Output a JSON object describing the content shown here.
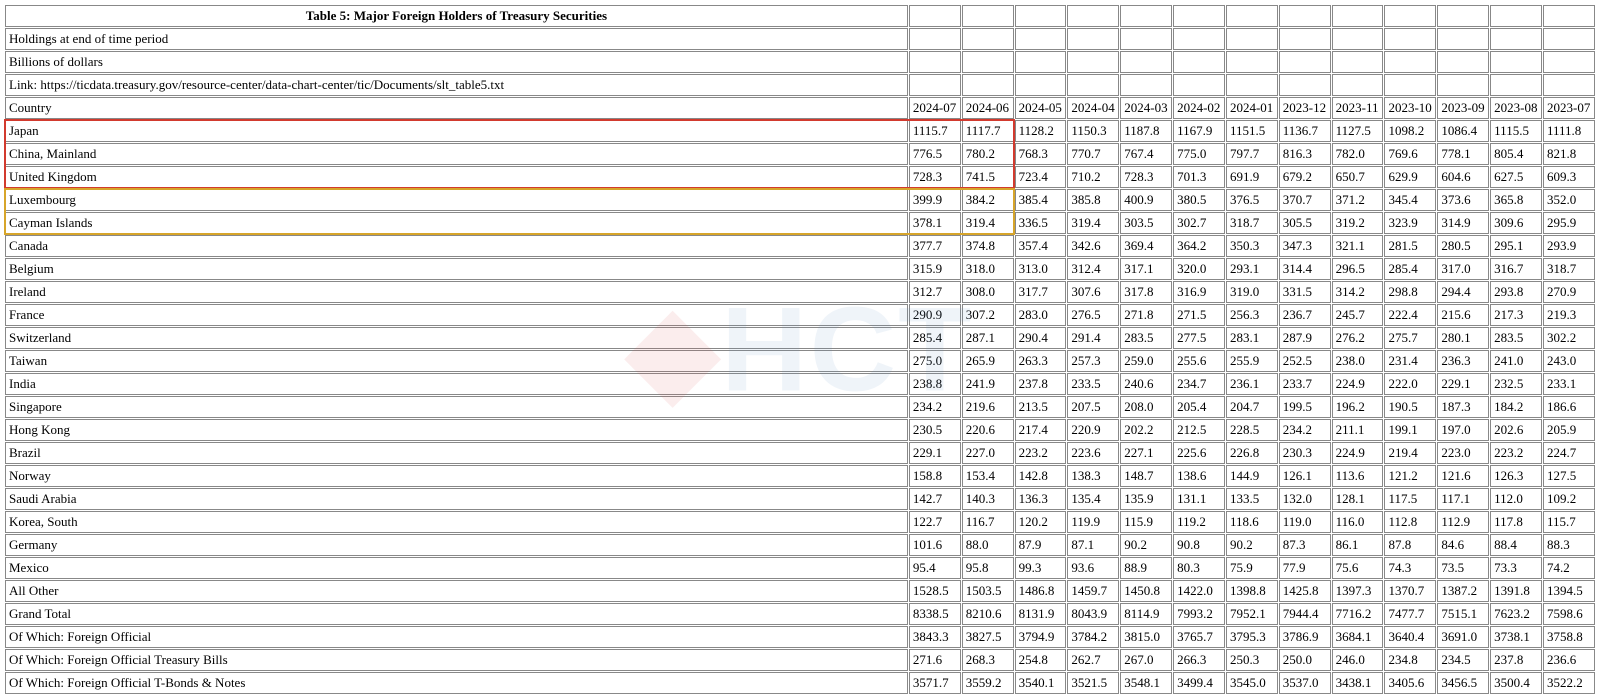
{
  "title": "Table 5: Major Foreign Holders of Treasury Securities",
  "meta": [
    "Holdings at end of time period",
    "Billions of dollars",
    "Link: https://ticdata.treasury.gov/resource-center/data-chart-center/tic/Documents/slt_table5.txt"
  ],
  "header_label": "Country",
  "periods": [
    "2024-07",
    "2024-06",
    "2024-05",
    "2024-04",
    "2024-03",
    "2024-02",
    "2024-01",
    "2023-12",
    "2023-11",
    "2023-10",
    "2023-09",
    "2023-08",
    "2023-07"
  ],
  "rows": [
    {
      "label": "Japan",
      "v": [
        "1115.7",
        "1117.7",
        "1128.2",
        "1150.3",
        "1187.8",
        "1167.9",
        "1151.5",
        "1136.7",
        "1127.5",
        "1098.2",
        "1086.4",
        "1115.5",
        "1111.8"
      ]
    },
    {
      "label": "China, Mainland",
      "v": [
        "776.5",
        "780.2",
        "768.3",
        "770.7",
        "767.4",
        "775.0",
        "797.7",
        "816.3",
        "782.0",
        "769.6",
        "778.1",
        "805.4",
        "821.8"
      ]
    },
    {
      "label": "United Kingdom",
      "v": [
        "728.3",
        "741.5",
        "723.4",
        "710.2",
        "728.3",
        "701.3",
        "691.9",
        "679.2",
        "650.7",
        "629.9",
        "604.6",
        "627.5",
        "609.3"
      ]
    },
    {
      "label": "Luxembourg",
      "v": [
        "399.9",
        "384.2",
        "385.4",
        "385.8",
        "400.9",
        "380.5",
        "376.5",
        "370.7",
        "371.2",
        "345.4",
        "373.6",
        "365.8",
        "352.0"
      ]
    },
    {
      "label": "Cayman Islands",
      "v": [
        "378.1",
        "319.4",
        "336.5",
        "319.4",
        "303.5",
        "302.7",
        "318.7",
        "305.5",
        "319.2",
        "323.9",
        "314.9",
        "309.6",
        "295.9"
      ]
    },
    {
      "label": "Canada",
      "v": [
        "377.7",
        "374.8",
        "357.4",
        "342.6",
        "369.4",
        "364.2",
        "350.3",
        "347.3",
        "321.1",
        "281.5",
        "280.5",
        "295.1",
        "293.9"
      ]
    },
    {
      "label": "Belgium",
      "v": [
        "315.9",
        "318.0",
        "313.0",
        "312.4",
        "317.1",
        "320.0",
        "293.1",
        "314.4",
        "296.5",
        "285.4",
        "317.0",
        "316.7",
        "318.7"
      ]
    },
    {
      "label": "Ireland",
      "v": [
        "312.7",
        "308.0",
        "317.7",
        "307.6",
        "317.8",
        "316.9",
        "319.0",
        "331.5",
        "314.2",
        "298.8",
        "294.4",
        "293.8",
        "270.9"
      ]
    },
    {
      "label": "France",
      "v": [
        "290.9",
        "307.2",
        "283.0",
        "276.5",
        "271.8",
        "271.5",
        "256.3",
        "236.7",
        "245.7",
        "222.4",
        "215.6",
        "217.3",
        "219.3"
      ]
    },
    {
      "label": "Switzerland",
      "v": [
        "285.4",
        "287.1",
        "290.4",
        "291.4",
        "283.5",
        "277.5",
        "283.1",
        "287.9",
        "276.2",
        "275.7",
        "280.1",
        "283.5",
        "302.2"
      ]
    },
    {
      "label": "Taiwan",
      "v": [
        "275.0",
        "265.9",
        "263.3",
        "257.3",
        "259.0",
        "255.6",
        "255.9",
        "252.5",
        "238.0",
        "231.4",
        "236.3",
        "241.0",
        "243.0"
      ]
    },
    {
      "label": "India",
      "v": [
        "238.8",
        "241.9",
        "237.8",
        "233.5",
        "240.6",
        "234.7",
        "236.1",
        "233.7",
        "224.9",
        "222.0",
        "229.1",
        "232.5",
        "233.1"
      ]
    },
    {
      "label": "Singapore",
      "v": [
        "234.2",
        "219.6",
        "213.5",
        "207.5",
        "208.0",
        "205.4",
        "204.7",
        "199.5",
        "196.2",
        "190.5",
        "187.3",
        "184.2",
        "186.6"
      ]
    },
    {
      "label": "Hong Kong",
      "v": [
        "230.5",
        "220.6",
        "217.4",
        "220.9",
        "202.2",
        "212.5",
        "228.5",
        "234.2",
        "211.1",
        "199.1",
        "197.0",
        "202.6",
        "205.9"
      ]
    },
    {
      "label": "Brazil",
      "v": [
        "229.1",
        "227.0",
        "223.2",
        "223.6",
        "227.1",
        "225.6",
        "226.8",
        "230.3",
        "224.9",
        "219.4",
        "223.0",
        "223.2",
        "224.7"
      ]
    },
    {
      "label": "Norway",
      "v": [
        "158.8",
        "153.4",
        "142.8",
        "138.3",
        "148.7",
        "138.6",
        "144.9",
        "126.1",
        "113.6",
        "121.2",
        "121.6",
        "126.3",
        "127.5"
      ]
    },
    {
      "label": "Saudi Arabia",
      "v": [
        "142.7",
        "140.3",
        "136.3",
        "135.4",
        "135.9",
        "131.1",
        "133.5",
        "132.0",
        "128.1",
        "117.5",
        "117.1",
        "112.0",
        "109.2"
      ]
    },
    {
      "label": "Korea, South",
      "v": [
        "122.7",
        "116.7",
        "120.2",
        "119.9",
        "115.9",
        "119.2",
        "118.6",
        "119.0",
        "116.0",
        "112.8",
        "112.9",
        "117.8",
        "115.7"
      ]
    },
    {
      "label": "Germany",
      "v": [
        "101.6",
        "88.0",
        "87.9",
        "87.1",
        "90.2",
        "90.8",
        "90.2",
        "87.3",
        "86.1",
        "87.8",
        "84.6",
        "88.4",
        "88.3"
      ]
    },
    {
      "label": "Mexico",
      "v": [
        "95.4",
        "95.8",
        "99.3",
        "93.6",
        "88.9",
        "80.3",
        "75.9",
        "77.9",
        "75.6",
        "74.3",
        "73.5",
        "73.3",
        "74.2"
      ]
    },
    {
      "label": "All Other",
      "v": [
        "1528.5",
        "1503.5",
        "1486.8",
        "1459.7",
        "1450.8",
        "1422.0",
        "1398.8",
        "1425.8",
        "1397.3",
        "1370.7",
        "1387.2",
        "1391.8",
        "1394.5"
      ]
    },
    {
      "label": "Grand Total",
      "v": [
        "8338.5",
        "8210.6",
        "8131.9",
        "8043.9",
        "8114.9",
        "7993.2",
        "7952.1",
        "7944.4",
        "7716.2",
        "7477.7",
        "7515.1",
        "7623.2",
        "7598.6"
      ]
    },
    {
      "label": "Of Which: Foreign Official",
      "v": [
        "3843.3",
        "3827.5",
        "3794.9",
        "3784.2",
        "3815.0",
        "3765.7",
        "3795.3",
        "3786.9",
        "3684.1",
        "3640.4",
        "3691.0",
        "3738.1",
        "3758.8"
      ]
    },
    {
      "label": "Of Which: Foreign Official Treasury Bills",
      "v": [
        "271.6",
        "268.3",
        "254.8",
        "262.7",
        "267.0",
        "266.3",
        "250.3",
        "250.0",
        "246.0",
        "234.8",
        "234.5",
        "237.8",
        "236.6"
      ]
    },
    {
      "label": "Of Which: Foreign Official T-Bonds & Notes",
      "v": [
        "3571.7",
        "3559.2",
        "3540.1",
        "3521.5",
        "3548.1",
        "3499.4",
        "3545.0",
        "3537.0",
        "3438.1",
        "3405.6",
        "3456.5",
        "3500.4",
        "3522.2"
      ]
    }
  ],
  "watermark": "HCT",
  "chart_data": {
    "type": "table",
    "title": "Table 5: Major Foreign Holders of Treasury Securities",
    "unit": "Billions of dollars",
    "x": [
      "2024-07",
      "2024-06",
      "2024-05",
      "2024-04",
      "2024-03",
      "2024-02",
      "2024-01",
      "2023-12",
      "2023-11",
      "2023-10",
      "2023-09",
      "2023-08",
      "2023-07"
    ],
    "series": [
      {
        "name": "Japan",
        "values": [
          1115.7,
          1117.7,
          1128.2,
          1150.3,
          1187.8,
          1167.9,
          1151.5,
          1136.7,
          1127.5,
          1098.2,
          1086.4,
          1115.5,
          1111.8
        ]
      },
      {
        "name": "China, Mainland",
        "values": [
          776.5,
          780.2,
          768.3,
          770.7,
          767.4,
          775.0,
          797.7,
          816.3,
          782.0,
          769.6,
          778.1,
          805.4,
          821.8
        ]
      },
      {
        "name": "United Kingdom",
        "values": [
          728.3,
          741.5,
          723.4,
          710.2,
          728.3,
          701.3,
          691.9,
          679.2,
          650.7,
          629.9,
          604.6,
          627.5,
          609.3
        ]
      },
      {
        "name": "Luxembourg",
        "values": [
          399.9,
          384.2,
          385.4,
          385.8,
          400.9,
          380.5,
          376.5,
          370.7,
          371.2,
          345.4,
          373.6,
          365.8,
          352.0
        ]
      },
      {
        "name": "Cayman Islands",
        "values": [
          378.1,
          319.4,
          336.5,
          319.4,
          303.5,
          302.7,
          318.7,
          305.5,
          319.2,
          323.9,
          314.9,
          309.6,
          295.9
        ]
      },
      {
        "name": "Canada",
        "values": [
          377.7,
          374.8,
          357.4,
          342.6,
          369.4,
          364.2,
          350.3,
          347.3,
          321.1,
          281.5,
          280.5,
          295.1,
          293.9
        ]
      },
      {
        "name": "Belgium",
        "values": [
          315.9,
          318.0,
          313.0,
          312.4,
          317.1,
          320.0,
          293.1,
          314.4,
          296.5,
          285.4,
          317.0,
          316.7,
          318.7
        ]
      },
      {
        "name": "Ireland",
        "values": [
          312.7,
          308.0,
          317.7,
          307.6,
          317.8,
          316.9,
          319.0,
          331.5,
          314.2,
          298.8,
          294.4,
          293.8,
          270.9
        ]
      },
      {
        "name": "France",
        "values": [
          290.9,
          307.2,
          283.0,
          276.5,
          271.8,
          271.5,
          256.3,
          236.7,
          245.7,
          222.4,
          215.6,
          217.3,
          219.3
        ]
      },
      {
        "name": "Switzerland",
        "values": [
          285.4,
          287.1,
          290.4,
          291.4,
          283.5,
          277.5,
          283.1,
          287.9,
          276.2,
          275.7,
          280.1,
          283.5,
          302.2
        ]
      },
      {
        "name": "Taiwan",
        "values": [
          275.0,
          265.9,
          263.3,
          257.3,
          259.0,
          255.6,
          255.9,
          252.5,
          238.0,
          231.4,
          236.3,
          241.0,
          243.0
        ]
      },
      {
        "name": "India",
        "values": [
          238.8,
          241.9,
          237.8,
          233.5,
          240.6,
          234.7,
          236.1,
          233.7,
          224.9,
          222.0,
          229.1,
          232.5,
          233.1
        ]
      },
      {
        "name": "Singapore",
        "values": [
          234.2,
          219.6,
          213.5,
          207.5,
          208.0,
          205.4,
          204.7,
          199.5,
          196.2,
          190.5,
          187.3,
          184.2,
          186.6
        ]
      },
      {
        "name": "Hong Kong",
        "values": [
          230.5,
          220.6,
          217.4,
          220.9,
          202.2,
          212.5,
          228.5,
          234.2,
          211.1,
          199.1,
          197.0,
          202.6,
          205.9
        ]
      },
      {
        "name": "Brazil",
        "values": [
          229.1,
          227.0,
          223.2,
          223.6,
          227.1,
          225.6,
          226.8,
          230.3,
          224.9,
          219.4,
          223.0,
          223.2,
          224.7
        ]
      },
      {
        "name": "Norway",
        "values": [
          158.8,
          153.4,
          142.8,
          138.3,
          148.7,
          138.6,
          144.9,
          126.1,
          113.6,
          121.2,
          121.6,
          126.3,
          127.5
        ]
      },
      {
        "name": "Saudi Arabia",
        "values": [
          142.7,
          140.3,
          136.3,
          135.4,
          135.9,
          131.1,
          133.5,
          132.0,
          128.1,
          117.5,
          117.1,
          112.0,
          109.2
        ]
      },
      {
        "name": "Korea, South",
        "values": [
          122.7,
          116.7,
          120.2,
          119.9,
          115.9,
          119.2,
          118.6,
          119.0,
          116.0,
          112.8,
          112.9,
          117.8,
          115.7
        ]
      },
      {
        "name": "Germany",
        "values": [
          101.6,
          88.0,
          87.9,
          87.1,
          90.2,
          90.8,
          90.2,
          87.3,
          86.1,
          87.8,
          84.6,
          88.4,
          88.3
        ]
      },
      {
        "name": "Mexico",
        "values": [
          95.4,
          95.8,
          99.3,
          93.6,
          88.9,
          80.3,
          75.9,
          77.9,
          75.6,
          74.3,
          73.5,
          73.3,
          74.2
        ]
      },
      {
        "name": "All Other",
        "values": [
          1528.5,
          1503.5,
          1486.8,
          1459.7,
          1450.8,
          1422.0,
          1398.8,
          1425.8,
          1397.3,
          1370.7,
          1387.2,
          1391.8,
          1394.5
        ]
      },
      {
        "name": "Grand Total",
        "values": [
          8338.5,
          8210.6,
          8131.9,
          8043.9,
          8114.9,
          7993.2,
          7952.1,
          7944.4,
          7716.2,
          7477.7,
          7515.1,
          7623.2,
          7598.6
        ]
      },
      {
        "name": "Of Which: Foreign Official",
        "values": [
          3843.3,
          3827.5,
          3794.9,
          3784.2,
          3815.0,
          3765.7,
          3795.3,
          3786.9,
          3684.1,
          3640.4,
          3691.0,
          3738.1,
          3758.8
        ]
      },
      {
        "name": "Of Which: Foreign Official Treasury Bills",
        "values": [
          271.6,
          268.3,
          254.8,
          262.7,
          267.0,
          266.3,
          250.3,
          250.0,
          246.0,
          234.8,
          234.5,
          237.8,
          236.6
        ]
      },
      {
        "name": "Of Which: Foreign Official T-Bonds & Notes",
        "values": [
          3571.7,
          3559.2,
          3540.1,
          3521.5,
          3548.1,
          3499.4,
          3545.0,
          3537.0,
          3438.1,
          3405.6,
          3456.5,
          3500.4,
          3522.2
        ]
      }
    ]
  },
  "highlights": {
    "red": {
      "row_start": 5,
      "row_end": 7,
      "col_start": 0,
      "col_end": 2
    },
    "gold": {
      "row_start": 8,
      "row_end": 9,
      "col_start": 0,
      "col_end": 2
    }
  }
}
